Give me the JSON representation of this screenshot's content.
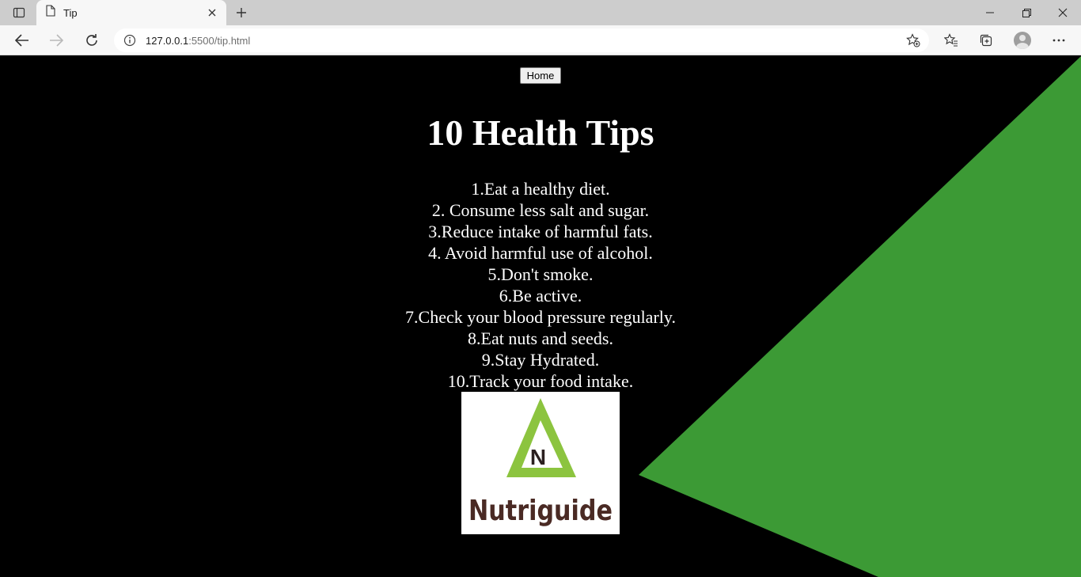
{
  "browser": {
    "tab": {
      "title": "Tip",
      "icon": "page-icon"
    },
    "address": {
      "host": "127.0.0.1",
      "rest": ":5500/tip.html"
    },
    "accent": "#cdcdcd"
  },
  "page": {
    "home_button": "Home",
    "title": "10 Health Tips",
    "tips": [
      "1.Eat a healthy diet.",
      "2. Consume less salt and sugar.",
      "3.Reduce intake of harmful fats.",
      "4. Avoid harmful use of alcohol.",
      "5.Don't smoke.",
      "6.Be active.",
      "7.Check your blood pressure regularly.",
      "8.Eat nuts and seeds.",
      "9.Stay Hydrated.",
      "10.Track your food intake."
    ],
    "logo": {
      "letter": "N",
      "brand": "Nutriguide"
    },
    "colors": {
      "background": "#000000",
      "triangle": "#3c9a35",
      "logo_green": "#8cc43f",
      "logo_text": "#4a2a24"
    }
  }
}
